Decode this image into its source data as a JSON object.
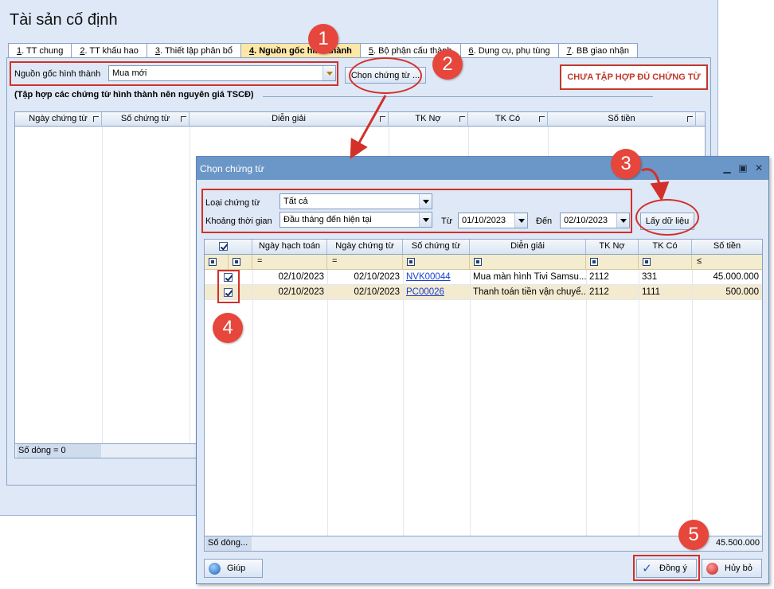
{
  "main": {
    "title": "Tài sản cố định",
    "tabs": [
      {
        "num": "1",
        "label": ". TT chung"
      },
      {
        "num": "2",
        "label": ". TT khấu hao"
      },
      {
        "num": "3",
        "label": ". Thiết lập phân bổ"
      },
      {
        "num": "4",
        "label": ". Nguồn gốc hình thành"
      },
      {
        "num": "5",
        "label": ". Bộ phận cấu thành"
      },
      {
        "num": "6",
        "label": ". Dụng cụ, phụ tùng"
      },
      {
        "num": "7",
        "label": ". BB giao nhận"
      }
    ],
    "origin_label": "Nguồn gốc hình thành",
    "origin_value": "Mua mới",
    "choose_button": "Chọn chứng từ ...",
    "warning": "CHƯA TẬP HỢP ĐỦ CHỨNG TỪ",
    "group_title": "(Tập hợp các chứng từ hình thành nên nguyên giá TSCĐ)",
    "columns": [
      "Ngày chứng từ",
      "Số chứng từ",
      "Diễn giải",
      "TK Nợ",
      "TK Có",
      "Số tiền"
    ],
    "row_count": "Số dòng = 0"
  },
  "dialog": {
    "title": "Chọn chứng từ",
    "type_label": "Loại chứng từ",
    "type_value": "Tất cả",
    "period_label": "Khoảng thời gian",
    "period_value": "Đầu tháng đến hiện tại",
    "from_label": "Từ",
    "from_value": "01/10/2023",
    "to_label": "Đến",
    "to_value": "02/10/2023",
    "fetch_button": "Lấy dữ liệu",
    "columns": [
      "Ngày hạch toán",
      "Ngày chứng từ",
      "Số chứng từ",
      "Diễn giải",
      "TK Nợ",
      "TK Có",
      "Số tiền"
    ],
    "filter_ops": [
      "=",
      "=",
      "≤"
    ],
    "rows": [
      {
        "checked": true,
        "posting_date": "02/10/2023",
        "doc_date": "02/10/2023",
        "doc_no": "NVK00044",
        "desc": "Mua màn hình Tivi Samsu...",
        "debit": "2112",
        "credit": "331",
        "amount": "45.000.000"
      },
      {
        "checked": true,
        "posting_date": "02/10/2023",
        "doc_date": "02/10/2023",
        "doc_no": "PC00026",
        "desc": "Thanh toán tiền vận chuyể...",
        "debit": "2112",
        "credit": "1111",
        "amount": "500.000"
      }
    ],
    "row_count": "Số dòng...",
    "total": "45.500.000",
    "help_button": "Giúp",
    "ok_button": "Đồng ý",
    "cancel_button": "Hủy bỏ"
  },
  "annotations": [
    "1",
    "2",
    "3",
    "4",
    "5"
  ],
  "colors": {
    "accent_red": "#d2302a",
    "badge_red": "#e6463b",
    "titlebar": "#6b96c8",
    "active_tab": "#ffe7a6"
  }
}
